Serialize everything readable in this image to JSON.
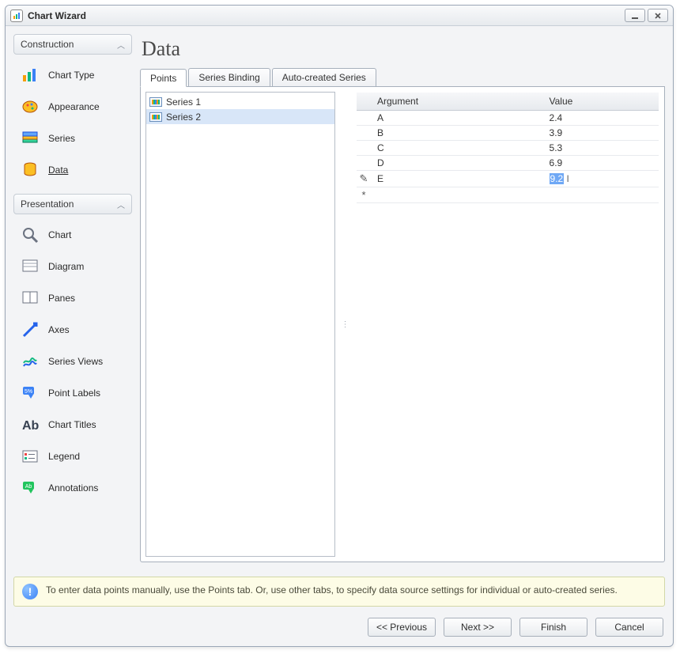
{
  "window_title": "Chart Wizard",
  "sidebar": {
    "groups": [
      {
        "header": "Construction",
        "items": [
          {
            "label": "Chart Type",
            "name": "chart-type",
            "active": false
          },
          {
            "label": "Appearance",
            "name": "appearance",
            "active": false
          },
          {
            "label": "Series",
            "name": "series",
            "active": false
          },
          {
            "label": "Data",
            "name": "data",
            "active": true
          }
        ]
      },
      {
        "header": "Presentation",
        "items": [
          {
            "label": "Chart",
            "name": "chart",
            "active": false
          },
          {
            "label": "Diagram",
            "name": "diagram",
            "active": false
          },
          {
            "label": "Panes",
            "name": "panes",
            "active": false
          },
          {
            "label": "Axes",
            "name": "axes",
            "active": false
          },
          {
            "label": "Series Views",
            "name": "series-views",
            "active": false
          },
          {
            "label": "Point Labels",
            "name": "point-labels",
            "active": false
          },
          {
            "label": "Chart Titles",
            "name": "chart-titles",
            "active": false
          },
          {
            "label": "Legend",
            "name": "legend",
            "active": false
          },
          {
            "label": "Annotations",
            "name": "annotations",
            "active": false
          }
        ]
      }
    ]
  },
  "page_title": "Data",
  "tabs": [
    {
      "label": "Points",
      "active": true
    },
    {
      "label": "Series Binding",
      "active": false
    },
    {
      "label": "Auto-created Series",
      "active": false
    }
  ],
  "series_list": [
    {
      "label": "Series 1",
      "selected": false
    },
    {
      "label": "Series 2",
      "selected": true
    }
  ],
  "grid": {
    "columns": [
      "Argument",
      "Value"
    ],
    "rows": [
      {
        "indicator": "",
        "argument": "A",
        "value": "2.4",
        "editing": false
      },
      {
        "indicator": "",
        "argument": "B",
        "value": "3.9",
        "editing": false
      },
      {
        "indicator": "",
        "argument": "C",
        "value": "5.3",
        "editing": false
      },
      {
        "indicator": "",
        "argument": "D",
        "value": "6.9",
        "editing": false
      },
      {
        "indicator": "✎",
        "argument": "E",
        "value": "9.2",
        "editing": true
      },
      {
        "indicator": "*",
        "argument": "",
        "value": "",
        "editing": false
      }
    ]
  },
  "info_text": "To enter data points manually, use the Points tab. Or, use other tabs, to specify data source settings for individual or auto-created series.",
  "buttons": {
    "previous": "<< Previous",
    "next": "Next >>",
    "finish": "Finish",
    "cancel": "Cancel"
  },
  "chart_data": {
    "type": "table",
    "note": "Data points being entered for Series 2 in the wizard grid",
    "columns": [
      "Argument",
      "Value"
    ],
    "series": "Series 2",
    "rows": [
      {
        "Argument": "A",
        "Value": 2.4
      },
      {
        "Argument": "B",
        "Value": 3.9
      },
      {
        "Argument": "C",
        "Value": 5.3
      },
      {
        "Argument": "D",
        "Value": 6.9
      },
      {
        "Argument": "E",
        "Value": 9.2
      }
    ]
  }
}
